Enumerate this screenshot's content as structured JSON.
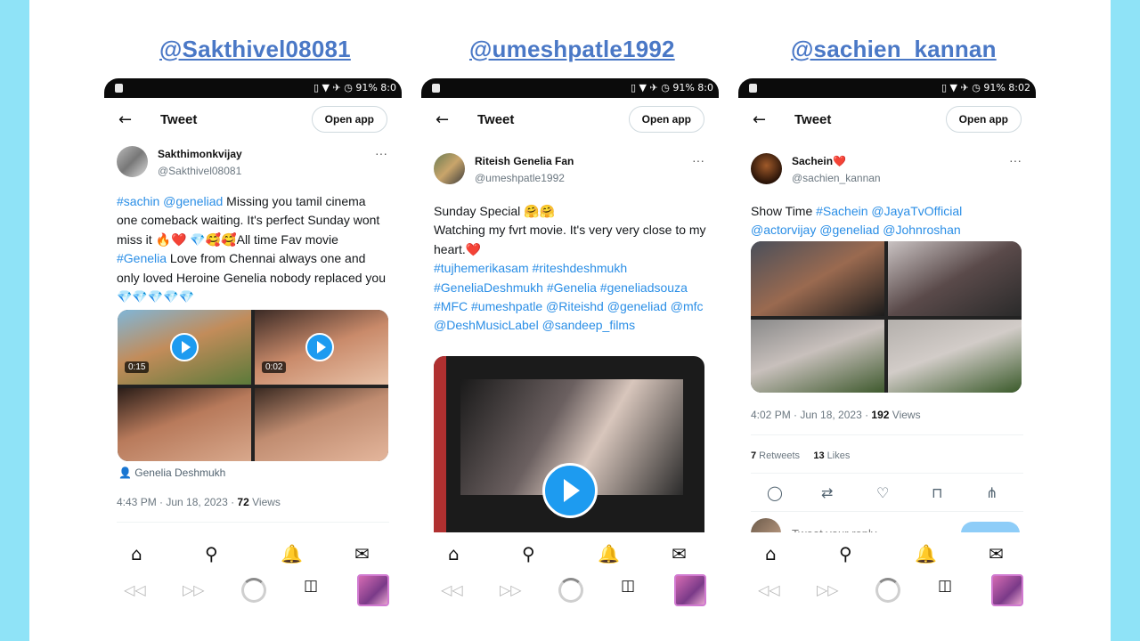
{
  "handles": [
    "@Sakthivel08081",
    "@umeshpatle1992",
    "@sachien_kannan"
  ],
  "status_icons": [
    "vibrate-icon",
    "wifi-icon",
    "airplane-icon",
    "alarm-icon"
  ],
  "phones": [
    {
      "status": {
        "battery": "91%",
        "time": "8:0"
      },
      "topbar": {
        "title": "Tweet",
        "open_app": "Open app"
      },
      "author": {
        "name": "Sakthimonkvijay",
        "handle": "@Sakthivel08081"
      },
      "tweet": {
        "t1": "#sachin @geneliad",
        "t2": " Missing you tamil cinema one comeback waiting. It's perfect Sunday wont miss it 🔥❤️ 💎🥰🥰All time Fav movie ",
        "t3": "#Genelia",
        "t4": " Love from Chennai always one and only loved Heroine Genelia nobody replaced you 💎💎💎💎💎"
      },
      "media": {
        "durations": [
          "0:15",
          "0:02"
        ]
      },
      "tagged": "Genelia Deshmukh",
      "meta": {
        "time": "4:43 PM · Jun 18, 2023 · ",
        "views": "72",
        "views_label": " Views"
      }
    },
    {
      "status": {
        "battery": "91%",
        "time": "8:0"
      },
      "topbar": {
        "title": "Tweet",
        "open_app": "Open app"
      },
      "author": {
        "name": "Riteish Genelia Fan",
        "handle": "@umeshpatle1992"
      },
      "tweet": {
        "t1": "Sunday Special 🤗🤗",
        "t2": "Watching my fvrt movie. It's very very close to my heart.❤️",
        "t3": "#tujhemerikasam #riteshdeshmukh #GeneliaDeshmukh #Genelia #geneliadsouza #MFC #umeshpatle @Riteishd @geneliad @mfc @DeshMusicLabel @sandeep_films"
      }
    },
    {
      "status": {
        "battery": "91%",
        "time": "8:02"
      },
      "topbar": {
        "title": "Tweet",
        "open_app": "Open app"
      },
      "author": {
        "name": "Sachein❤️",
        "handle": "@sachien_kannan"
      },
      "tweet": {
        "t1": "Show Time ",
        "t2": "#Sachein @JayaTvOfficial @actorvijay @geneliad @Johnroshan"
      },
      "meta": {
        "time": "4:02 PM · Jun 18, 2023 · ",
        "views": "192",
        "views_label": " Views"
      },
      "stats": {
        "retweets": "7",
        "retweets_label": " Retweets",
        "likes": "13",
        "likes_label": " Likes"
      },
      "reply_placeholder": "Tweet your reply"
    }
  ],
  "action_icons": [
    "reply-icon",
    "retweet-icon",
    "like-icon",
    "bookmark-icon",
    "share-icon"
  ],
  "nav_icons": [
    "home-icon",
    "search-icon",
    "notifications-icon",
    "messages-icon"
  ],
  "browser_icons": [
    "back-icon",
    "forward-icon",
    "reload-icon",
    "tabs-icon",
    "profile-thumbnail"
  ]
}
